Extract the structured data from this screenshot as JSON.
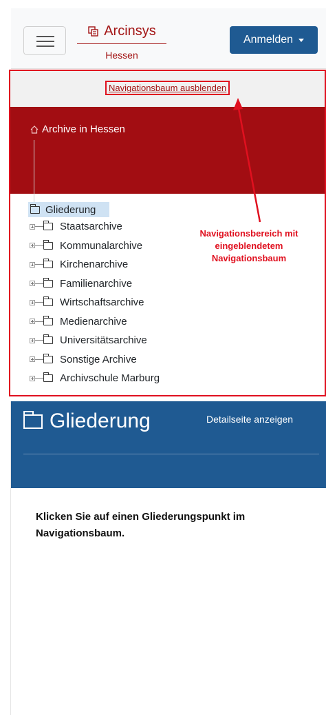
{
  "header": {
    "brand_name": "Arcinsys",
    "brand_region": "Hessen",
    "login_label": "Anmelden"
  },
  "nav": {
    "toggle_link": "Navigationsbaum ausblenden",
    "archive_label": "Archive in Hessen",
    "tree_root": "Gliederung",
    "items": [
      "Staatsarchive",
      "Kommunalarchive",
      "Kirchenarchive",
      "Familienarchive",
      "Wirtschaftsarchive",
      "Medienarchive",
      "Universitätsarchive",
      "Sonstige Archive",
      "Archivschule Marburg"
    ]
  },
  "annotation": {
    "text_line1": "Navigationsbereich mit",
    "text_line2": "eingeblendetem",
    "text_line3": "Navigationsbaum",
    "color": "#e0101f"
  },
  "detail": {
    "title": "Gliederung",
    "link": "Detailseite anzeigen",
    "message": "Klicken Sie auf einen Gliederungspunkt im Navigationsbaum."
  },
  "colors": {
    "brand_red": "#a31515",
    "band_red": "#a20d12",
    "primary_blue": "#1f5a92",
    "selected_bg": "#cfe2f3"
  },
  "icons": {
    "menu": "hamburger-icon",
    "brand": "archive-building-icon",
    "folder": "folder-icon",
    "expand": "plus-box-icon",
    "house": "house-icon"
  }
}
